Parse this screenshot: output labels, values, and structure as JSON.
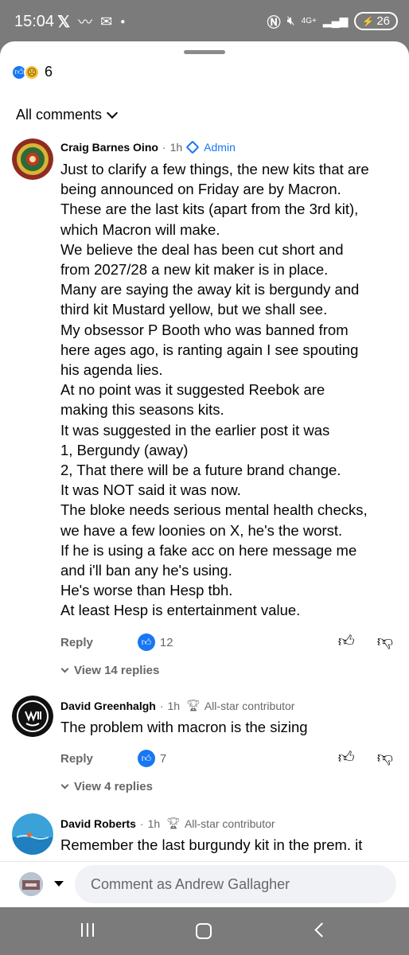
{
  "status_bar": {
    "time": "15:04",
    "battery": "26",
    "network": "4G+",
    "icons": [
      "x-icon",
      "mail-icon",
      "dot-icon",
      "nfc-icon",
      "mute-icon",
      "signal-icon",
      "battery-icon"
    ]
  },
  "post": {
    "reaction_count": "6",
    "reaction_types": [
      "like",
      "sad"
    ]
  },
  "comments_filter": {
    "label": "All comments"
  },
  "comments": [
    {
      "author": "Craig Barnes Oino",
      "time": "1h",
      "badge": "Admin",
      "text_lines": [
        "Just to clarify a few things, the new kits that are",
        "being announced on Friday are by Macron.",
        "These are the last kits (apart from the 3rd kit),",
        "which Macron will make.",
        "We believe the deal has been cut short and",
        "from 2027/28 a new kit maker is in place.",
        "Many are saying the away kit is bergundy and",
        "third kit Mustard yellow, but we shall see.",
        "My obsessor  P Booth who was banned from",
        "here ages ago, is ranting again I see spouting",
        "his agenda lies.",
        "At no point was it suggested Reebok are",
        "making this seasons kits.",
        "It was suggested in the earlier post it was",
        "1, Bergundy (away)",
        "2, That there will be a future brand change.",
        "It was NOT said it was now.",
        "The bloke needs serious mental health checks,",
        "we have a few loonies on X, he's the worst.",
        "If he is using a fake acc on here message me",
        "and i'll ban any he's using.",
        "He's worse than Hesp tbh.",
        "At least Hesp is entertainment value."
      ],
      "reply_label": "Reply",
      "likes": "12",
      "view_replies": "View 14 replies"
    },
    {
      "author": "David Greenhalgh",
      "time": "1h",
      "badge": "All-star contributor",
      "text_lines": [
        "The problem with macron is the sizing"
      ],
      "reply_label": "Reply",
      "likes": "7",
      "view_replies": "View 4 replies"
    },
    {
      "author": "David Roberts",
      "time": "1h",
      "badge": "All-star contributor",
      "text_lines": [
        "Remember the last burgundy kit in the prem. it"
      ]
    }
  ],
  "composer": {
    "placeholder": "Comment as Andrew Gallagher"
  },
  "colors": {
    "accent": "#1877f2",
    "secondary_text": "#65676b",
    "status_bar_bg": "#7b7b7b"
  }
}
